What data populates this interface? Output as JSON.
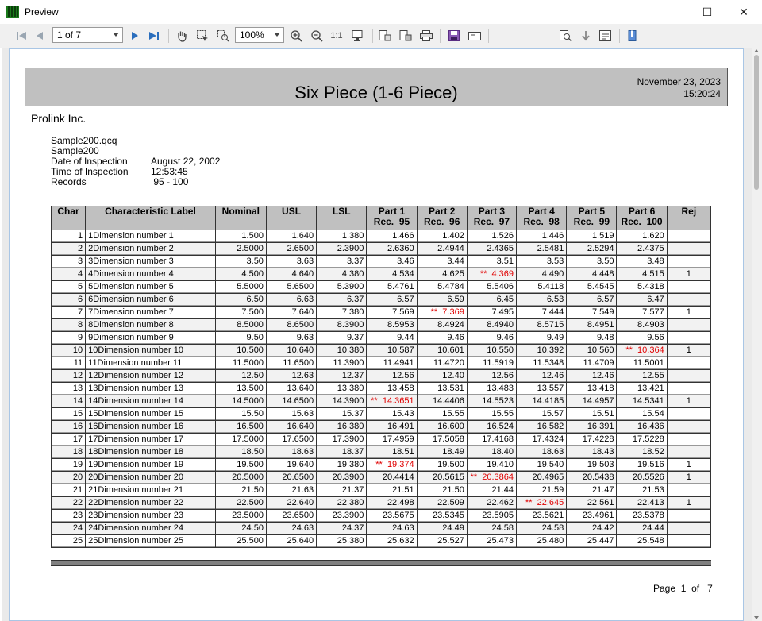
{
  "window": {
    "title": "Preview",
    "controls": {
      "minimize": "—",
      "maximize": "☐",
      "close": "✕"
    }
  },
  "toolbar": {
    "page_selector": "1 of 7",
    "zoom": "100%",
    "actual_size": "1:1",
    "search_value": ""
  },
  "report": {
    "title": "Six Piece (1-6 Piece)",
    "date": "November 23, 2023",
    "time": "15:20:24",
    "company": "Prolink Inc.",
    "file": "Sample200.qcq",
    "sample": "Sample200",
    "info": [
      {
        "label": "Date of Inspection",
        "value": "August 22, 2002"
      },
      {
        "label": "Time of Inspection",
        "value": "12:53:45"
      },
      {
        "label": "Records",
        "value": " 95 - 100"
      }
    ],
    "page_label": "Page",
    "page_num": "1",
    "page_of": "of",
    "page_total": "7"
  },
  "table": {
    "headers": {
      "char": "Char",
      "label": "Characteristic Label",
      "nominal": "Nominal",
      "usl": "USL",
      "lsl": "LSL",
      "p1a": "Part 1",
      "p1b": "Rec.  95",
      "p2a": "Part 2",
      "p2b": "Rec.  96",
      "p3a": "Part 3",
      "p3b": "Rec.  97",
      "p4a": "Part 4",
      "p4b": "Rec.  98",
      "p5a": "Part 5",
      "p5b": "Rec.  99",
      "p6a": "Part 6",
      "p6b": "Rec.  100",
      "rej": "Rej"
    },
    "rows": [
      {
        "char": "1",
        "label": "1Dimension number 1",
        "nominal": "1.500",
        "usl": "1.640",
        "lsl": "1.380",
        "p": [
          "1.466",
          "1.402",
          "1.526",
          "1.446",
          "1.519",
          "1.620"
        ],
        "rej": ""
      },
      {
        "char": "2",
        "label": "2Dimension number 2",
        "nominal": "2.5000",
        "usl": "2.6500",
        "lsl": "2.3900",
        "p": [
          "2.6360",
          "2.4944",
          "2.4365",
          "2.5481",
          "2.5294",
          "2.4375"
        ],
        "rej": ""
      },
      {
        "char": "3",
        "label": "3Dimension number 3",
        "nominal": "3.50",
        "usl": "3.63",
        "lsl": "3.37",
        "p": [
          "3.46",
          "3.44",
          "3.51",
          "3.53",
          "3.50",
          "3.48"
        ],
        "rej": ""
      },
      {
        "char": "4",
        "label": "4Dimension number 4",
        "nominal": "4.500",
        "usl": "4.640",
        "lsl": "4.380",
        "p": [
          "4.534",
          "4.625",
          "**  4.369",
          "4.490",
          "4.448",
          "4.515"
        ],
        "rej": "1"
      },
      {
        "char": "5",
        "label": "5Dimension number 5",
        "nominal": "5.5000",
        "usl": "5.6500",
        "lsl": "5.3900",
        "p": [
          "5.4761",
          "5.4784",
          "5.5406",
          "5.4118",
          "5.4545",
          "5.4318"
        ],
        "rej": ""
      },
      {
        "char": "6",
        "label": "6Dimension number 6",
        "nominal": "6.50",
        "usl": "6.63",
        "lsl": "6.37",
        "p": [
          "6.57",
          "6.59",
          "6.45",
          "6.53",
          "6.57",
          "6.47"
        ],
        "rej": ""
      },
      {
        "char": "7",
        "label": "7Dimension number 7",
        "nominal": "7.500",
        "usl": "7.640",
        "lsl": "7.380",
        "p": [
          "7.569",
          "**  7.369",
          "7.495",
          "7.444",
          "7.549",
          "7.577"
        ],
        "rej": "1"
      },
      {
        "char": "8",
        "label": "8Dimension number 8",
        "nominal": "8.5000",
        "usl": "8.6500",
        "lsl": "8.3900",
        "p": [
          "8.5953",
          "8.4924",
          "8.4940",
          "8.5715",
          "8.4951",
          "8.4903"
        ],
        "rej": ""
      },
      {
        "char": "9",
        "label": "9Dimension number 9",
        "nominal": "9.50",
        "usl": "9.63",
        "lsl": "9.37",
        "p": [
          "9.44",
          "9.46",
          "9.46",
          "9.49",
          "9.48",
          "9.56"
        ],
        "rej": ""
      },
      {
        "char": "10",
        "label": "10Dimension number 10",
        "nominal": "10.500",
        "usl": "10.640",
        "lsl": "10.380",
        "p": [
          "10.587",
          "10.601",
          "10.550",
          "10.392",
          "10.560",
          "**  10.364"
        ],
        "rej": "1"
      },
      {
        "char": "11",
        "label": "11Dimension number 11",
        "nominal": "11.5000",
        "usl": "11.6500",
        "lsl": "11.3900",
        "p": [
          "11.4941",
          "11.4720",
          "11.5919",
          "11.5348",
          "11.4709",
          "11.5001"
        ],
        "rej": ""
      },
      {
        "char": "12",
        "label": "12Dimension number 12",
        "nominal": "12.50",
        "usl": "12.63",
        "lsl": "12.37",
        "p": [
          "12.56",
          "12.40",
          "12.56",
          "12.46",
          "12.46",
          "12.55"
        ],
        "rej": ""
      },
      {
        "char": "13",
        "label": "13Dimension number 13",
        "nominal": "13.500",
        "usl": "13.640",
        "lsl": "13.380",
        "p": [
          "13.458",
          "13.531",
          "13.483",
          "13.557",
          "13.418",
          "13.421"
        ],
        "rej": ""
      },
      {
        "char": "14",
        "label": "14Dimension number 14",
        "nominal": "14.5000",
        "usl": "14.6500",
        "lsl": "14.3900",
        "p": [
          "**  14.3651",
          "14.4406",
          "14.5523",
          "14.4185",
          "14.4957",
          "14.5341"
        ],
        "rej": "1"
      },
      {
        "char": "15",
        "label": "15Dimension number 15",
        "nominal": "15.50",
        "usl": "15.63",
        "lsl": "15.37",
        "p": [
          "15.43",
          "15.55",
          "15.55",
          "15.57",
          "15.51",
          "15.54"
        ],
        "rej": ""
      },
      {
        "char": "16",
        "label": "16Dimension number 16",
        "nominal": "16.500",
        "usl": "16.640",
        "lsl": "16.380",
        "p": [
          "16.491",
          "16.600",
          "16.524",
          "16.582",
          "16.391",
          "16.436"
        ],
        "rej": ""
      },
      {
        "char": "17",
        "label": "17Dimension number 17",
        "nominal": "17.5000",
        "usl": "17.6500",
        "lsl": "17.3900",
        "p": [
          "17.4959",
          "17.5058",
          "17.4168",
          "17.4324",
          "17.4228",
          "17.5228"
        ],
        "rej": ""
      },
      {
        "char": "18",
        "label": "18Dimension number 18",
        "nominal": "18.50",
        "usl": "18.63",
        "lsl": "18.37",
        "p": [
          "18.51",
          "18.49",
          "18.40",
          "18.63",
          "18.43",
          "18.52"
        ],
        "rej": ""
      },
      {
        "char": "19",
        "label": "19Dimension number 19",
        "nominal": "19.500",
        "usl": "19.640",
        "lsl": "19.380",
        "p": [
          "**  19.374",
          "19.500",
          "19.410",
          "19.540",
          "19.503",
          "19.516"
        ],
        "rej": "1"
      },
      {
        "char": "20",
        "label": "20Dimension number 20",
        "nominal": "20.5000",
        "usl": "20.6500",
        "lsl": "20.3900",
        "p": [
          "20.4414",
          "20.5615",
          "**  20.3864",
          "20.4965",
          "20.5438",
          "20.5526"
        ],
        "rej": "1"
      },
      {
        "char": "21",
        "label": "21Dimension number 21",
        "nominal": "21.50",
        "usl": "21.63",
        "lsl": "21.37",
        "p": [
          "21.51",
          "21.50",
          "21.44",
          "21.59",
          "21.47",
          "21.53"
        ],
        "rej": ""
      },
      {
        "char": "22",
        "label": "22Dimension number 22",
        "nominal": "22.500",
        "usl": "22.640",
        "lsl": "22.380",
        "p": [
          "22.498",
          "22.509",
          "22.462",
          "**  22.645",
          "22.561",
          "22.413"
        ],
        "rej": "1"
      },
      {
        "char": "23",
        "label": "23Dimension number 23",
        "nominal": "23.5000",
        "usl": "23.6500",
        "lsl": "23.3900",
        "p": [
          "23.5675",
          "23.5345",
          "23.5905",
          "23.5621",
          "23.4961",
          "23.5378"
        ],
        "rej": ""
      },
      {
        "char": "24",
        "label": "24Dimension number 24",
        "nominal": "24.50",
        "usl": "24.63",
        "lsl": "24.37",
        "p": [
          "24.63",
          "24.49",
          "24.58",
          "24.58",
          "24.42",
          "24.44"
        ],
        "rej": ""
      },
      {
        "char": "25",
        "label": "25Dimension number 25",
        "nominal": "25.500",
        "usl": "25.640",
        "lsl": "25.380",
        "p": [
          "25.632",
          "25.527",
          "25.473",
          "25.480",
          "25.447",
          "25.548"
        ],
        "rej": ""
      }
    ],
    "out_of_spec_color": "#e00000"
  }
}
